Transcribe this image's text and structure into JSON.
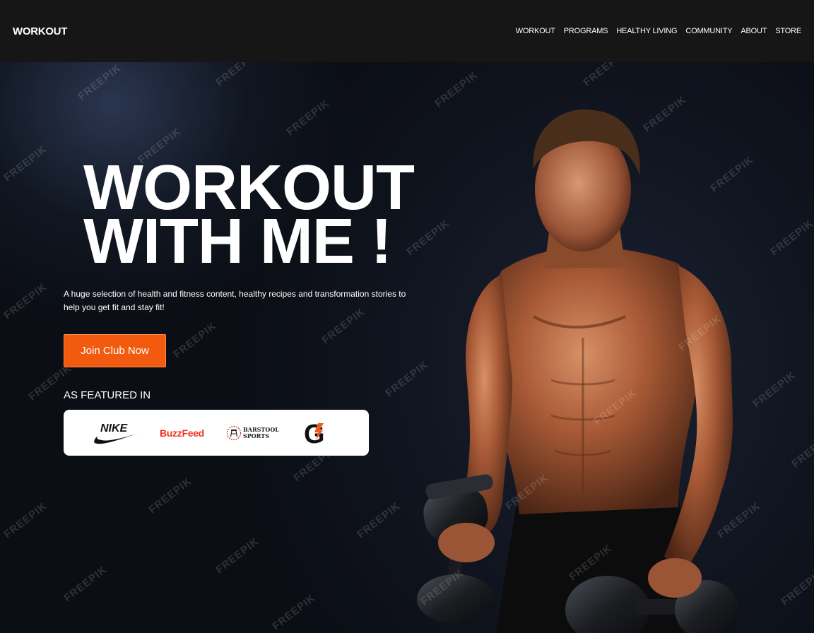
{
  "header": {
    "brand": "WORKOUT",
    "nav": [
      "WORKOUT",
      "PROGRAMS",
      "HEALTHY LIVING",
      "COMMUNITY",
      "ABOUT",
      "STORE"
    ]
  },
  "hero": {
    "headline_line1": "WORKOUT",
    "headline_line2": "WITH ME !",
    "subtext": "A huge selection of health and fitness content, healthy recipes and transformation stories to help you get fit and stay fit!",
    "cta_label": "Join Club Now",
    "featured_label": "AS FEATURED IN",
    "featured_logos": {
      "nike": "NIKE",
      "buzzfeed": "BuzzFeed",
      "barstool_line1": "BARSTOOL",
      "barstool_line2": "SPORTS",
      "gatorade": "G"
    },
    "watermark": "FREEPIK"
  },
  "colors": {
    "accent": "#f25a0f",
    "navbar_bg": "#161616",
    "hero_bg": "#0d111a"
  }
}
